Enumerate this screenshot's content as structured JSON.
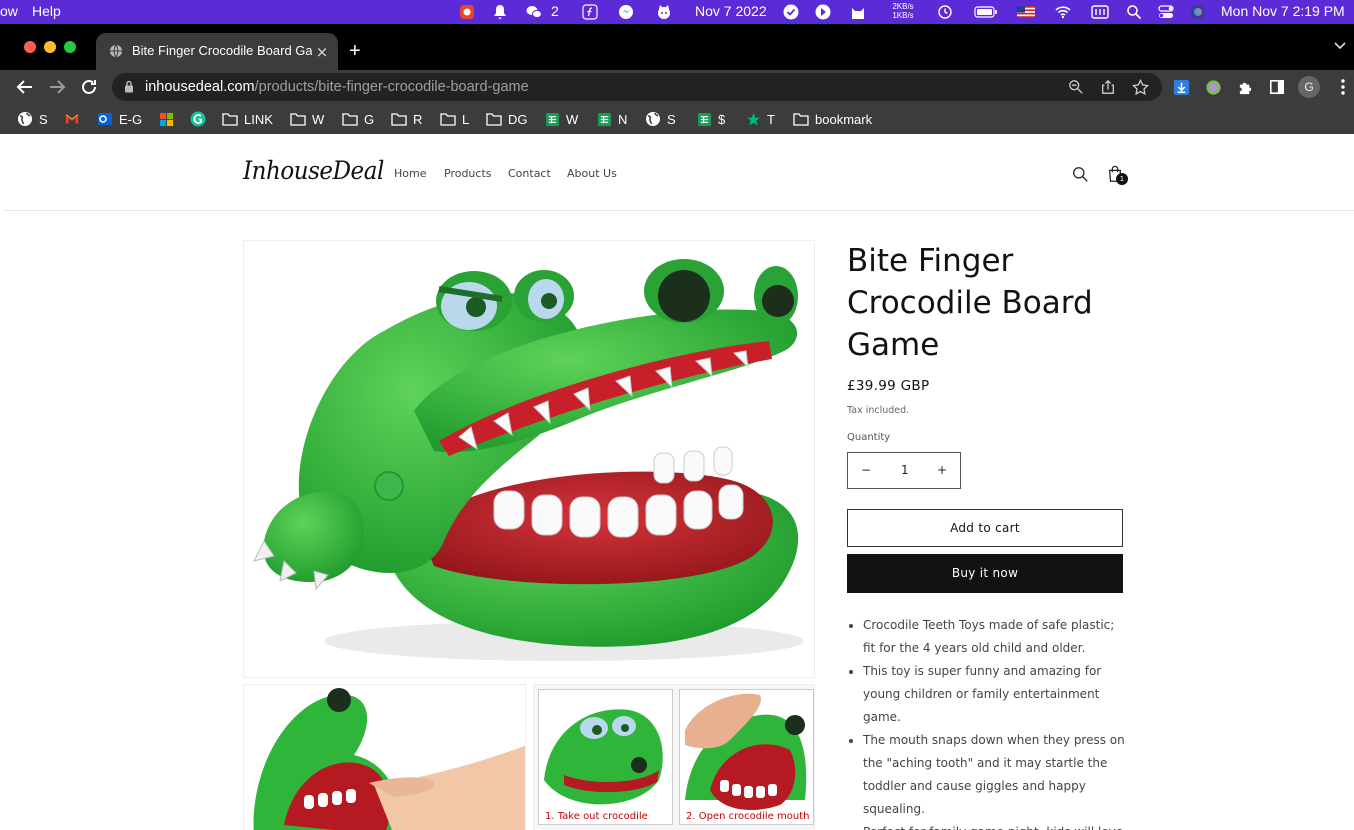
{
  "menubar": {
    "app_fragment": "ow",
    "help": "Help",
    "wechat_count": "2",
    "date_short": "Nov 7 2022",
    "net_up": "2KB/s",
    "net_down": "1KB/s",
    "clock": "Mon Nov 7  2:19 PM"
  },
  "tab": {
    "title": "Bite Finger Crocodile Board Game",
    "close": "×"
  },
  "newtab": "+",
  "address": {
    "host": "inhousedeal.com",
    "path": "/products/bite-finger-crocodile-board-game"
  },
  "bookmarks": [
    {
      "label": "S",
      "icon": "globe-icon"
    },
    {
      "label": "",
      "icon": "gmail-icon"
    },
    {
      "label": "E-G",
      "icon": "outlook-icon"
    },
    {
      "label": "",
      "icon": "microsoft-icon"
    },
    {
      "label": "",
      "icon": "grammarly-icon"
    },
    {
      "label": "LINK",
      "icon": "folder-icon"
    },
    {
      "label": "W",
      "icon": "folder-icon"
    },
    {
      "label": "G",
      "icon": "folder-icon"
    },
    {
      "label": "R",
      "icon": "folder-icon"
    },
    {
      "label": "L",
      "icon": "folder-icon"
    },
    {
      "label": "DG",
      "icon": "folder-icon"
    },
    {
      "label": "W",
      "icon": "sheets-icon"
    },
    {
      "label": "N",
      "icon": "sheets-icon"
    },
    {
      "label": "S",
      "icon": "globe-icon"
    },
    {
      "label": "$",
      "icon": "sheets-icon"
    },
    {
      "label": "T",
      "icon": "star-icon"
    },
    {
      "label": "bookmark",
      "icon": "folder-icon"
    }
  ],
  "profile_initial": "G",
  "store": {
    "logo": "InhouseDeal",
    "nav": [
      "Home",
      "Products",
      "Contact",
      "About Us"
    ],
    "cart_count": "1"
  },
  "product": {
    "title": "Bite Finger Crocodile Board Game",
    "price": "£39.99 GBP",
    "tax_note": "Tax included.",
    "quantity_label": "Quantity",
    "quantity": "1",
    "minus": "−",
    "plus": "+",
    "add_to_cart": "Add to cart",
    "buy_now": "Buy it now",
    "thumb_captions": [
      "1. Take out crocodile",
      "2. Open crocodile mouth"
    ],
    "description": [
      "Crocodile Teeth Toys made of safe plastic; fit for the 4 years old child and older.",
      "This toy is super funny and amazing for young children or family entertainment game.",
      "The mouth snaps down when they press on the \"aching tooth\" and it may startle the toddler and cause giggles and happy squealing.",
      "Perfect for family game night, kids will love"
    ]
  },
  "colors": {
    "menubar": "#5b2bd8",
    "chrome_dark": "#3c3c3c",
    "croc_green": "#2fb53a",
    "mouth_red": "#c8202a"
  }
}
